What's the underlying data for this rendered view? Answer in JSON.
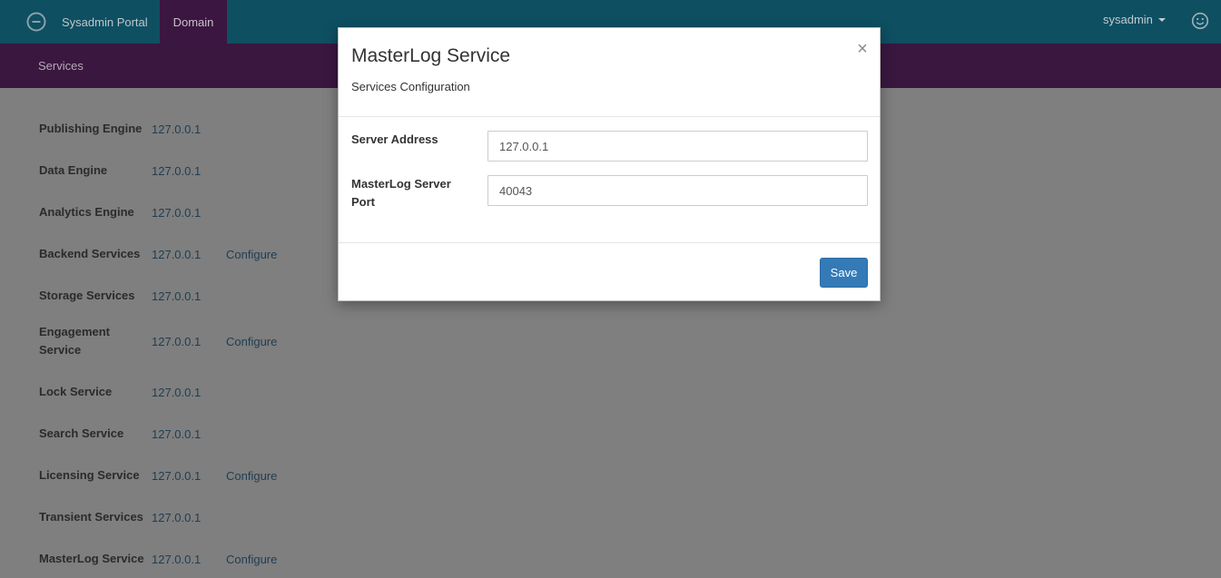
{
  "header": {
    "brand_name": "Sysadmin Portal",
    "nav_domain": "Domain",
    "user": "sysadmin"
  },
  "subnav": {
    "services": "Services"
  },
  "services": [
    {
      "name": "Publishing Engine",
      "address": "127.0.0.1",
      "action": ""
    },
    {
      "name": "Data Engine",
      "address": "127.0.0.1",
      "action": ""
    },
    {
      "name": "Analytics Engine",
      "address": "127.0.0.1",
      "action": ""
    },
    {
      "name": "Backend Services",
      "address": "127.0.0.1",
      "action": "Configure"
    },
    {
      "name": "Storage Services",
      "address": "127.0.0.1",
      "action": ""
    },
    {
      "name": "Engagement Service",
      "address": "127.0.0.1",
      "action": "Configure"
    },
    {
      "name": "Lock Service",
      "address": "127.0.0.1",
      "action": ""
    },
    {
      "name": "Search Service",
      "address": "127.0.0.1",
      "action": ""
    },
    {
      "name": "Licensing Service",
      "address": "127.0.0.1",
      "action": "Configure"
    },
    {
      "name": "Transient Services",
      "address": "127.0.0.1",
      "action": ""
    },
    {
      "name": "MasterLog Service",
      "address": "127.0.0.1",
      "action": "Configure"
    }
  ],
  "modal": {
    "title": "MasterLog Service",
    "subtitle": "Services Configuration",
    "close_glyph": "×",
    "fields": [
      {
        "label": "Server Address",
        "value": "127.0.0.1"
      },
      {
        "label": "MasterLog Server Port",
        "value": "40043"
      }
    ],
    "save_label": "Save"
  },
  "icons": {
    "brand": "logo-icon",
    "user_menu": "chevron-down-icon",
    "feedback": "smiley-icon"
  },
  "colors": {
    "topbar": "#0e4f62",
    "subbar": "#3a173f",
    "active_nav": "#3b1640",
    "primary_button": "#337ab7",
    "overlay_background": "#7f7f7f"
  }
}
